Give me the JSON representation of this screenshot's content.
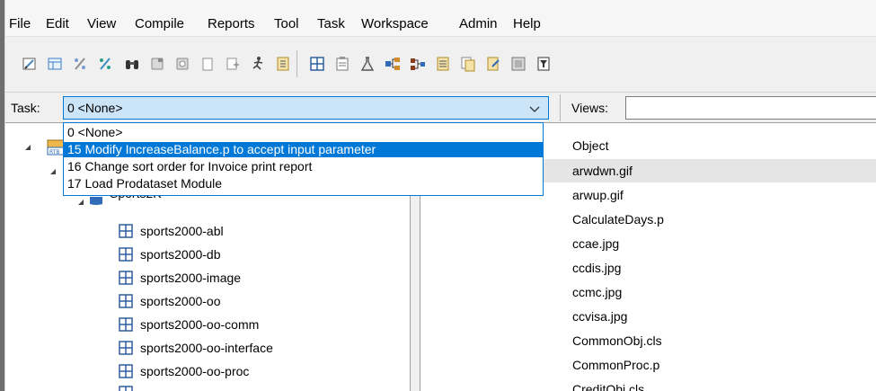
{
  "menu": [
    "File",
    "Edit",
    "View",
    "Compile",
    "Reports",
    "Tool",
    "Task",
    "Workspace",
    "Admin",
    "Help"
  ],
  "toolbar": {
    "icons": [
      "check-in-icon",
      "table-view-icon",
      "percent-icon",
      "percent-alt-icon",
      "binoculars-icon",
      "object-icon",
      "object-alt-icon",
      "page-icon",
      "copy-icon",
      "run-icon",
      "report-icon",
      "grid-icon",
      "clipboard-icon",
      "flask-icon",
      "tree-expand-icon",
      "tree-link-icon",
      "checklist-icon",
      "documents-icon",
      "document-edit-icon",
      "screen-icon",
      "filter-icon"
    ]
  },
  "task": {
    "label": "Task:",
    "value": "0 <None>",
    "options": [
      "0 <None>",
      "15 Modify IncreaseBalance.p to accept input parameter",
      "16 Change sort order for Invoice print report",
      "17 Load Prodataset Module"
    ],
    "highlighted_index": 1
  },
  "views": {
    "label": "Views:",
    "value": ""
  },
  "tree": {
    "partial_label": "Sports2K",
    "items": [
      "sports2000-abl",
      "sports2000-db",
      "sports2000-image",
      "sports2000-oo",
      "sports2000-oo-comm",
      "sports2000-oo-interface",
      "sports2000-oo-proc"
    ]
  },
  "objects": {
    "header": "Object",
    "items": [
      "arwdwn.gif",
      "arwup.gif",
      "CalculateDays.p",
      "ccae.jpg",
      "ccdis.jpg",
      "ccmc.jpg",
      "ccvisa.jpg",
      "CommonObj.cls",
      "CommonProc.p",
      "CreditObj.cls"
    ],
    "selected_index": 0
  },
  "colors": {
    "accent": "#0078d7",
    "combo_bg": "#cce4f7",
    "chrome": "#f0f0f0"
  }
}
